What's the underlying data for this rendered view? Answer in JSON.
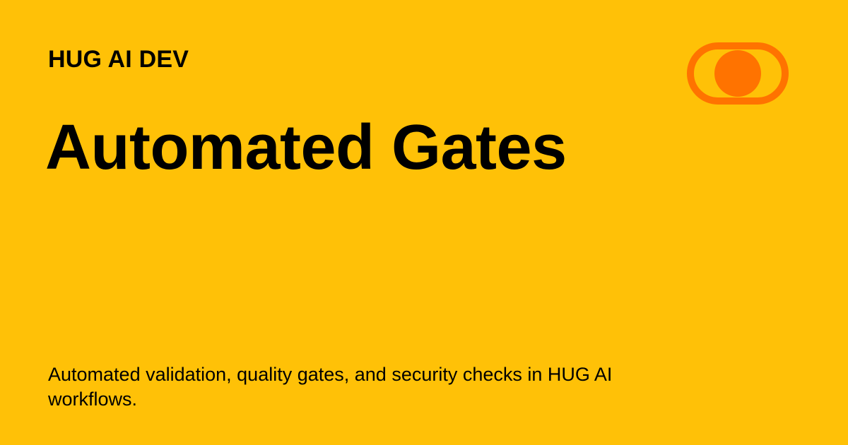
{
  "brand": {
    "name": "HUG AI DEV",
    "logo_icon": "toggle-switch-logo-icon",
    "logo_color": "#FF7300"
  },
  "hero": {
    "title": "Automated Gates",
    "description": "Automated validation, quality gates, and security checks in HUG AI workflows."
  },
  "theme": {
    "background": "#FFC107",
    "text": "#000000"
  }
}
